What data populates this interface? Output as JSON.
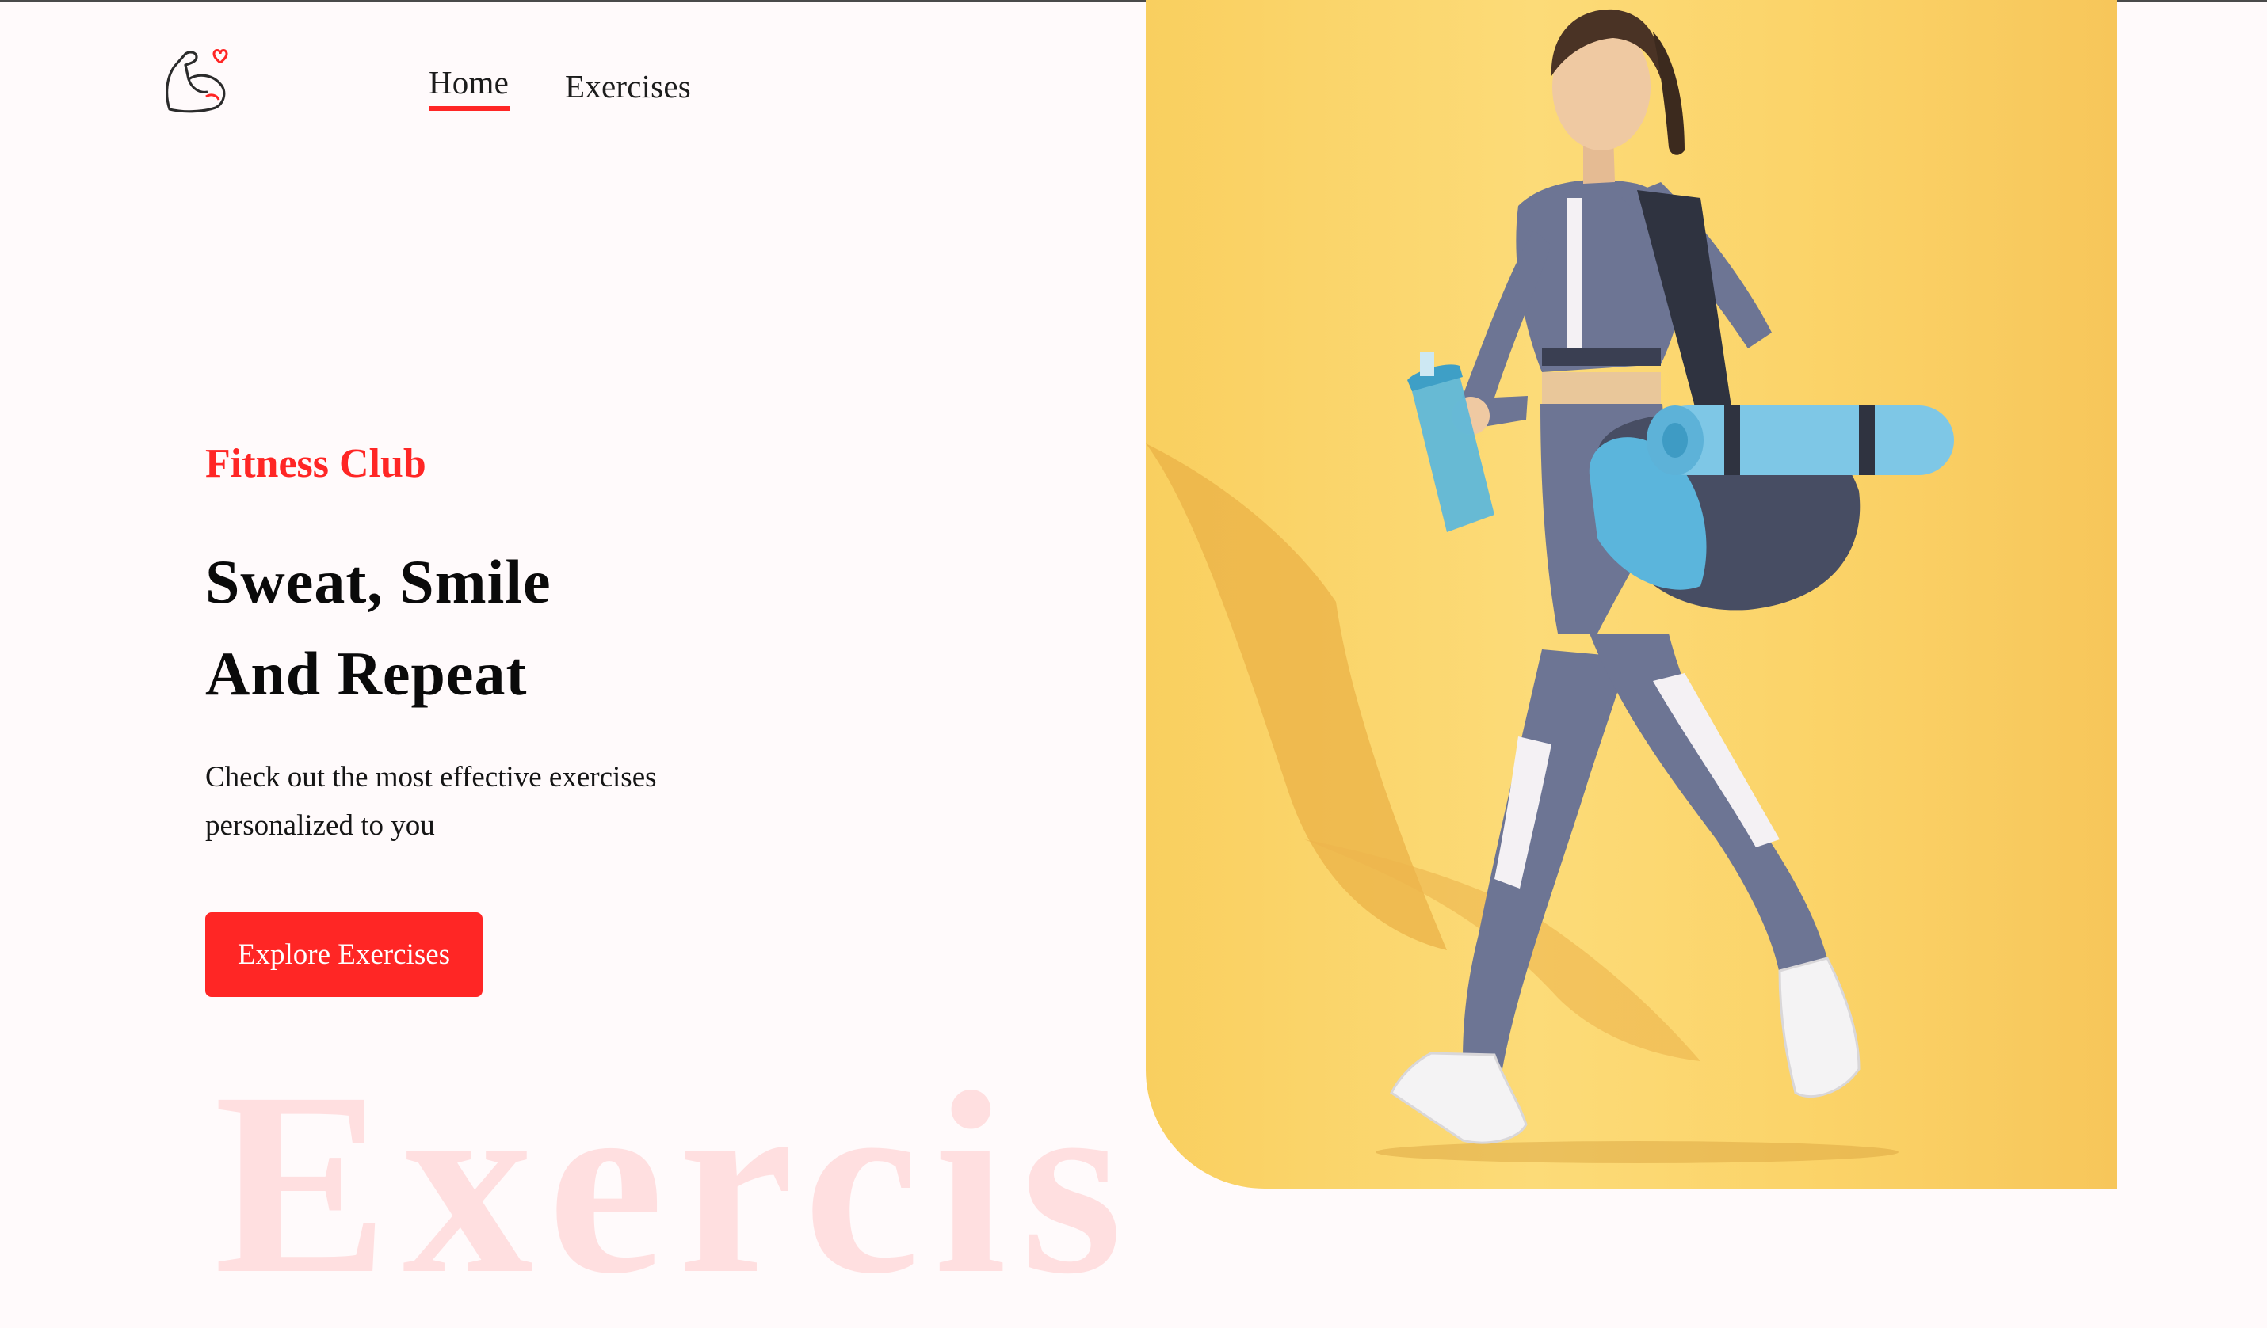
{
  "header": {
    "logo_icon": "flexed-arm-heart-icon",
    "nav": {
      "home_label": "Home",
      "exercises_label": "Exercises",
      "active": "Home"
    }
  },
  "hero": {
    "kicker": "Fitness Club",
    "headline_line1": "Sweat, Smile",
    "headline_line2": "And Repeat",
    "description_line1": "Check out the most effective exercises",
    "description_line2": "personalized to you",
    "cta_label": "Explore Exercises",
    "watermark_text": "Exercis",
    "banner_image": "woman-walking-with-gym-bag-and-shaker-image"
  },
  "colors": {
    "accent": "#FF2625",
    "background": "#FFFAFB",
    "hero_bg": "#FCDB78"
  }
}
